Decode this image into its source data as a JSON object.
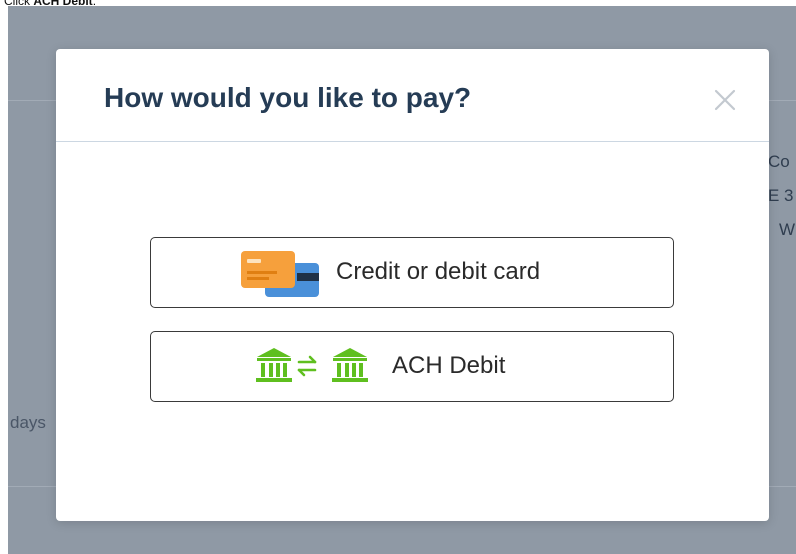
{
  "instruction": {
    "prefix": "Click ",
    "target": "ACH Debit",
    "suffix": "."
  },
  "background": {
    "fragments": [
      "Co",
      "E 3",
      "W",
      "days"
    ]
  },
  "modal": {
    "title": "How would you like to pay?",
    "close_icon": "close-icon",
    "options": [
      {
        "label": "Credit or debit card",
        "icon": "credit-card-icon"
      },
      {
        "label": "ACH Debit",
        "icon": "bank-transfer-icon"
      }
    ]
  },
  "colors": {
    "title": "#253c55",
    "card_orange": "#f6a03c",
    "card_blue": "#4a90d9",
    "bank_green": "#5fbf1f",
    "backdrop": "#8f99a5"
  }
}
